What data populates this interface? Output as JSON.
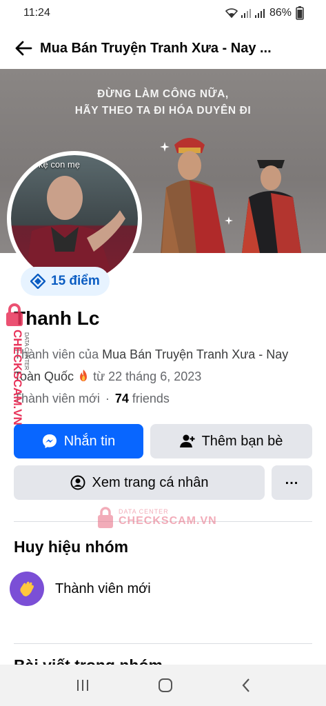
{
  "status_bar": {
    "time": "11:24",
    "battery": "86%"
  },
  "header": {
    "title": "Mua Bán Truyện Tranh Xưa - Nay ..."
  },
  "cover": {
    "line1": "ĐỪNG LÀM CÔNG NỮA,",
    "line2": "HÃY THEO TA ĐI HÓA DUYÊN ĐI"
  },
  "avatar": {
    "caption": "kệ con mẹ"
  },
  "profile": {
    "points": "15 điểm",
    "name": "Thanh Lc",
    "member_prefix": "Thành viên của ",
    "group_name": "Mua Bán Truyện Tranh Xưa - Nay Toàn Quốc",
    "member_since": " từ 22 tháng 6, 2023",
    "status": "Thành viên mới",
    "friends_count": "74",
    "friends_label": "friends"
  },
  "actions": {
    "message": "Nhắn tin",
    "add_friend": "Thêm bạn bè",
    "view_profile": "Xem trang cá nhân",
    "more": "..."
  },
  "badges_section": {
    "title": "Huy hiệu nhóm",
    "badge_label": "Thành viên mới"
  },
  "posts_section": {
    "title": "Bài viết trong nhóm"
  },
  "watermark": {
    "line1": "DATA CENTER",
    "line2": "CHECKSCAM.VN"
  },
  "colors": {
    "primary": "#0866ff",
    "secondary_btn": "#e4e6eb",
    "badge_purple": "#7b4fd6"
  }
}
